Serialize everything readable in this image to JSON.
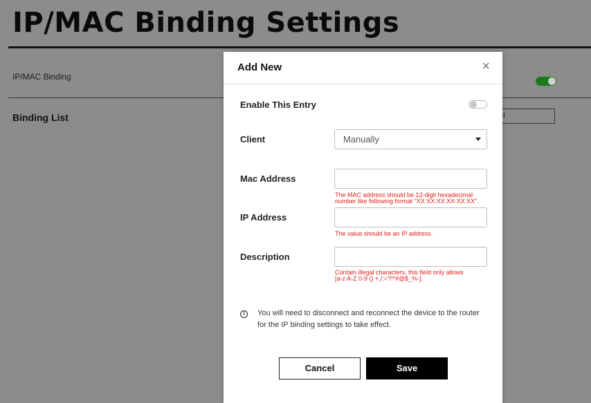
{
  "page": {
    "title": "IP/MAC Binding Settings",
    "binding_label": "IP/MAC Binding",
    "binding_enabled": true,
    "list_title": "Binding List",
    "partial_button_text": "I"
  },
  "modal": {
    "title": "Add New",
    "close_symbol": "×",
    "enable_label": "Enable This Entry",
    "enable_on": false,
    "client_label": "Client",
    "client_value": "Manually",
    "mac_label": "Mac Address",
    "mac_error_line1": "The MAC address should be 12-digit hexadecimal",
    "mac_error_line2": "number like following format \"XX:XX:XX:XX:XX:XX\".",
    "ip_label": "IP Address",
    "ip_error": "The value should be an IP address.",
    "desc_label": "Description",
    "desc_error_line1": "Contain illegal characters, this field only allows",
    "desc_error_line2": "[a-z A-Z 0-9 () +,/:=?!*#@$_%-].",
    "info_symbol": "i",
    "info_line1": "You will need to disconnect and reconnect the device to the router",
    "info_line2": "for the IP binding settings to take effect.",
    "cancel_label": "Cancel",
    "save_label": "Save"
  },
  "colors": {
    "overlay": "#8c8c8c",
    "toggle_on": "#1b7a1b",
    "error": "#e0201b",
    "save_bg": "#000000"
  },
  "icons": [
    "close-icon",
    "chevron-down-icon",
    "info-icon",
    "toggle-switch"
  ]
}
